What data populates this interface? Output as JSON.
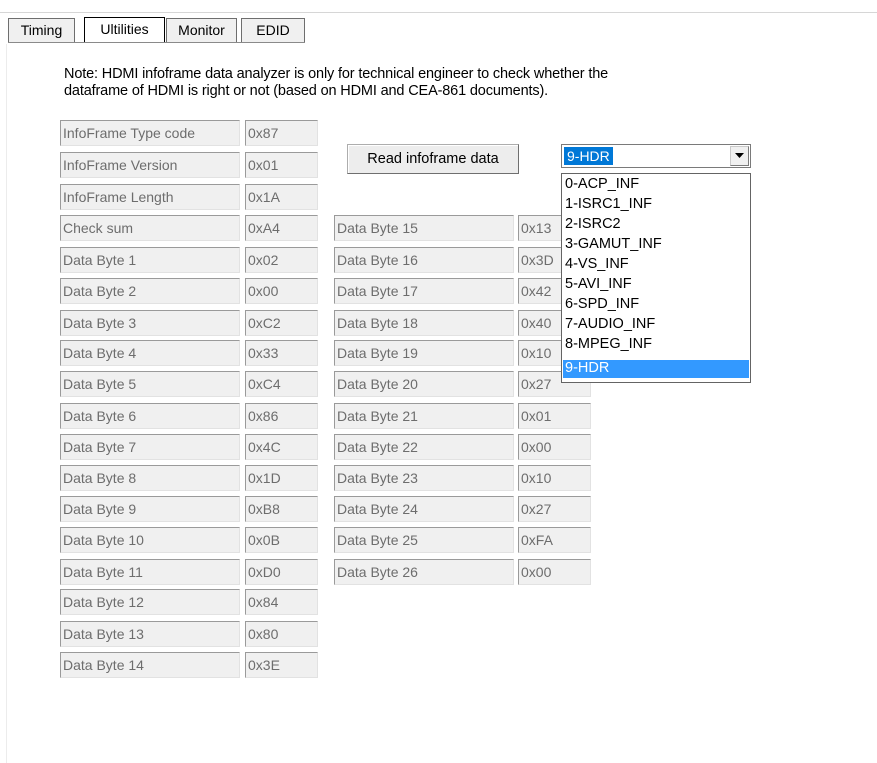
{
  "tabs": [
    "Timing",
    "Ultilities",
    "Monitor",
    "EDID"
  ],
  "note_line1": "Note: HDMI infoframe data analyzer is only for  technical engineer to check whether the",
  "note_line2": "dataframe of HDMI is right or not (based on HDMI and CEA-861 documents).",
  "header_fields": [
    {
      "label": "InfoFrame Type code",
      "value": "0x87"
    },
    {
      "label": "InfoFrame Version",
      "value": "0x01"
    },
    {
      "label": "InfoFrame Length",
      "value": "0x1A"
    }
  ],
  "left_fields": [
    {
      "label": "Check sum",
      "value": "0xA4"
    },
    {
      "label": "Data Byte 1",
      "value": "0x02"
    },
    {
      "label": "Data Byte 2",
      "value": "0x00"
    },
    {
      "label": "Data Byte 3",
      "value": "0xC2"
    },
    {
      "label": "Data Byte 4",
      "value": "0x33"
    },
    {
      "label": "Data Byte 5",
      "value": "0xC4"
    },
    {
      "label": "Data Byte 6",
      "value": "0x86"
    },
    {
      "label": "Data Byte 7",
      "value": "0x4C"
    },
    {
      "label": "Data Byte 8",
      "value": "0x1D"
    },
    {
      "label": "Data Byte 9",
      "value": "0xB8"
    },
    {
      "label": "Data Byte 10",
      "value": "0x0B"
    },
    {
      "label": "Data Byte 11",
      "value": "0xD0"
    },
    {
      "label": "Data Byte 12",
      "value": "0x84"
    },
    {
      "label": "Data Byte 13",
      "value": "0x80"
    },
    {
      "label": "Data Byte 14",
      "value": "0x3E"
    }
  ],
  "right_fields": [
    {
      "label": "Data Byte 15",
      "value": "0x13"
    },
    {
      "label": "Data Byte 16",
      "value": "0x3D"
    },
    {
      "label": "Data Byte 17",
      "value": "0x42"
    },
    {
      "label": "Data Byte 18",
      "value": "0x40"
    },
    {
      "label": "Data Byte 19",
      "value": "0x10"
    },
    {
      "label": "Data Byte 20",
      "value": "0x27"
    },
    {
      "label": "Data Byte 21",
      "value": "0x01"
    },
    {
      "label": "Data Byte 22",
      "value": "0x00"
    },
    {
      "label": "Data Byte 23",
      "value": "0x10"
    },
    {
      "label": "Data Byte 24",
      "value": "0x27"
    },
    {
      "label": "Data Byte 25",
      "value": "0xFA"
    },
    {
      "label": "Data Byte 26",
      "value": "0x00"
    }
  ],
  "read_button_label": "Read infoframe data",
  "combo": {
    "selected": "9-HDR",
    "arrow_icon": "chevron-down-icon",
    "options": [
      "0-ACP_INF",
      "1-ISRC1_INF",
      "2-ISRC2",
      "3-GAMUT_INF",
      "4-VS_INF",
      "5-AVI_INF",
      "6-SPD_INF",
      "7-AUDIO_INF",
      "8-MPEG_INF",
      "9-HDR"
    ]
  },
  "colors": {
    "selection": "#3399ff",
    "combo_highlight": "#0078d7"
  }
}
